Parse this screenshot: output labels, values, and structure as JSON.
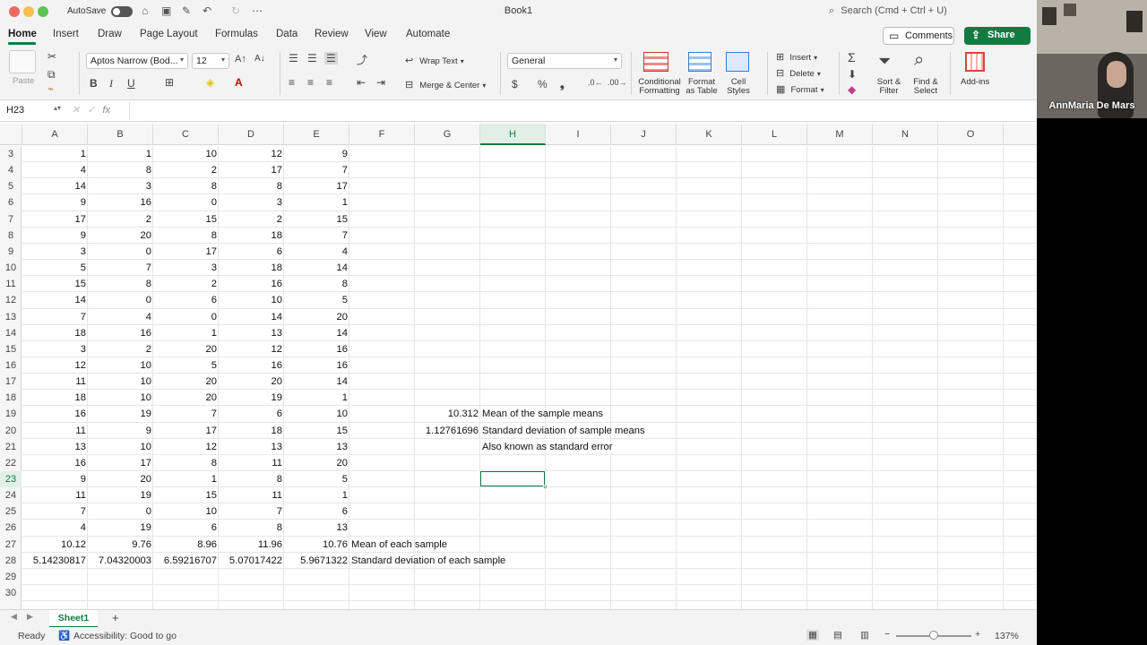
{
  "window": {
    "title": "Book1"
  },
  "titlebar": {
    "autosave_label": "AutoSave",
    "search_placeholder": "Search (Cmd + Ctrl + U)"
  },
  "ribbon_tabs": [
    "Home",
    "Insert",
    "Draw",
    "Page Layout",
    "Formulas",
    "Data",
    "Review",
    "View",
    "Automate"
  ],
  "active_tab": "Home",
  "actions": {
    "comments": "Comments",
    "share": "Share"
  },
  "ribbon": {
    "paste": "Paste",
    "font_name": "Aptos Narrow (Bod...",
    "font_size": "12",
    "wrap_text": "Wrap Text",
    "merge_center": "Merge & Center",
    "number_format": "General",
    "conditional_formatting": [
      "Conditional",
      "Formatting"
    ],
    "format_as_table": [
      "Format",
      "as Table"
    ],
    "cell_styles": [
      "Cell",
      "Styles"
    ],
    "insert": "Insert",
    "delete": "Delete",
    "format": "Format",
    "sort_filter": [
      "Sort &",
      "Filter"
    ],
    "find_select": [
      "Find &",
      "Select"
    ],
    "add_ins": "Add-ins"
  },
  "formula_bar": {
    "name_box": "H23",
    "fx": "fx",
    "formula": ""
  },
  "columns": [
    "A",
    "B",
    "C",
    "D",
    "E",
    "F",
    "G",
    "H",
    "I",
    "J",
    "K",
    "L",
    "M",
    "N",
    "O"
  ],
  "selected_column": "H",
  "rows": [
    "3",
    "4",
    "5",
    "6",
    "7",
    "8",
    "9",
    "10",
    "11",
    "12",
    "13",
    "14",
    "15",
    "16",
    "17",
    "18",
    "19",
    "20",
    "21",
    "22",
    "23",
    "24",
    "25",
    "26",
    "27",
    "28",
    "29",
    "30"
  ],
  "selected_row": "23",
  "sheet_values": [
    [
      "1",
      "1",
      "10",
      "12",
      "9"
    ],
    [
      "4",
      "8",
      "2",
      "17",
      "7"
    ],
    [
      "14",
      "3",
      "8",
      "8",
      "17"
    ],
    [
      "9",
      "16",
      "0",
      "3",
      "1"
    ],
    [
      "17",
      "2",
      "15",
      "2",
      "15"
    ],
    [
      "9",
      "20",
      "8",
      "18",
      "7"
    ],
    [
      "3",
      "0",
      "17",
      "6",
      "4"
    ],
    [
      "5",
      "7",
      "3",
      "18",
      "14"
    ],
    [
      "15",
      "8",
      "2",
      "16",
      "8"
    ],
    [
      "14",
      "0",
      "6",
      "10",
      "5"
    ],
    [
      "7",
      "4",
      "0",
      "14",
      "20"
    ],
    [
      "18",
      "16",
      "1",
      "13",
      "14"
    ],
    [
      "3",
      "2",
      "20",
      "12",
      "16"
    ],
    [
      "12",
      "10",
      "5",
      "16",
      "16"
    ],
    [
      "11",
      "10",
      "20",
      "20",
      "14"
    ],
    [
      "18",
      "10",
      "20",
      "19",
      "1"
    ],
    [
      "16",
      "19",
      "7",
      "6",
      "10"
    ],
    [
      "11",
      "9",
      "17",
      "18",
      "15"
    ],
    [
      "13",
      "10",
      "12",
      "13",
      "13"
    ],
    [
      "16",
      "17",
      "8",
      "11",
      "20"
    ],
    [
      "9",
      "20",
      "1",
      "8",
      "5"
    ],
    [
      "11",
      "19",
      "15",
      "11",
      "1"
    ],
    [
      "7",
      "0",
      "10",
      "7",
      "6"
    ],
    [
      "4",
      "19",
      "6",
      "8",
      "13"
    ],
    [
      "10.12",
      "9.76",
      "8.96",
      "11.96",
      "10.76"
    ],
    [
      "5.14230817",
      "7.04320003",
      "6.59216707",
      "5.07017422",
      "5.9671322"
    ]
  ],
  "annotations": {
    "g19": "10.312",
    "h19": "Mean of the sample means",
    "g20": "1.12761696",
    "h20": "Standard deviation of sample means",
    "h21": "Also known as standard error",
    "f27": "Mean of each sample",
    "f28": "Standard deviation of each sample"
  },
  "sheet_tabs": [
    "Sheet1"
  ],
  "add_sheet": "+",
  "status": {
    "ready": "Ready",
    "accessibility": "Accessibility: Good to go",
    "zoom": "137%",
    "zoom_level": 0.5
  },
  "webcam": {
    "name": "AnnMaria De Mars"
  }
}
